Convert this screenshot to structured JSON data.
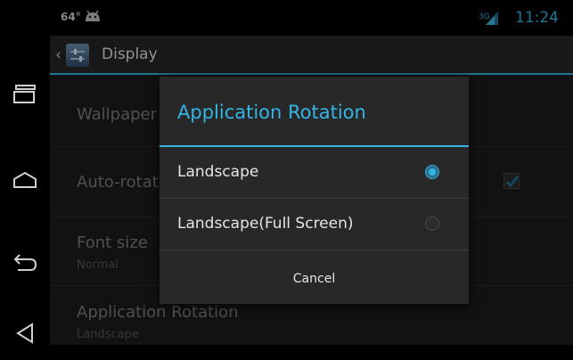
{
  "status": {
    "temperature": "64°",
    "network": "3G",
    "time": "11:24"
  },
  "actionbar": {
    "title": "Display"
  },
  "settings": [
    {
      "title": "Wallpaper",
      "subtitle": ""
    },
    {
      "title": "Auto-rotate screen",
      "subtitle": ""
    },
    {
      "title": "Font size",
      "subtitle": "Normal"
    },
    {
      "title": "Application Rotation",
      "subtitle": "Landscape"
    }
  ],
  "dialog": {
    "title": "Application Rotation",
    "options": [
      {
        "label": "Landscape",
        "selected": true
      },
      {
        "label": "Landscape(Full Screen)",
        "selected": false
      }
    ],
    "cancel_label": "Cancel"
  },
  "colors": {
    "accent": "#33b5e5",
    "dialog_bg": "#282828",
    "screen_bg": "#1d1d1d"
  }
}
